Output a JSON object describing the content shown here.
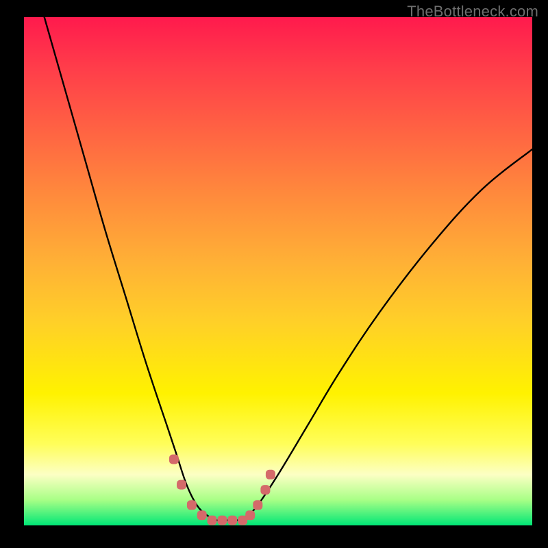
{
  "watermark": "TheBottleneck.com",
  "colors": {
    "page_bg": "#000000",
    "gradient_top": "#ff1a4d",
    "gradient_bottom": "#00e676",
    "curve_stroke": "#000000",
    "marker_fill": "#d46a6a"
  },
  "chart_data": {
    "type": "line",
    "title": "",
    "xlabel": "",
    "ylabel": "",
    "xlim": [
      0,
      100
    ],
    "ylim": [
      0,
      100
    ],
    "grid": false,
    "legend": false,
    "note": "Axes unlabeled; values estimated from curve shape against gradient. y≈0 near the bottom (green), y≈100 near the top (red).",
    "series": [
      {
        "name": "curve",
        "x": [
          4,
          8,
          12,
          16,
          20,
          24,
          28,
          30,
          32,
          34,
          36,
          38,
          40,
          42,
          44,
          46,
          50,
          56,
          62,
          70,
          80,
          90,
          100
        ],
        "y": [
          100,
          86,
          72,
          58,
          45,
          32,
          20,
          14,
          8,
          4,
          2,
          1,
          1,
          1,
          2,
          4,
          10,
          20,
          30,
          42,
          55,
          66,
          74
        ]
      }
    ],
    "markers": {
      "name": "highlighted-points",
      "color": "#d46a6a",
      "x": [
        29.5,
        31,
        33,
        35,
        37,
        39,
        41,
        43,
        44.5,
        46,
        47.5,
        48.5
      ],
      "y": [
        13,
        8,
        4,
        2,
        1,
        1,
        1,
        1,
        2,
        4,
        7,
        10
      ]
    }
  }
}
